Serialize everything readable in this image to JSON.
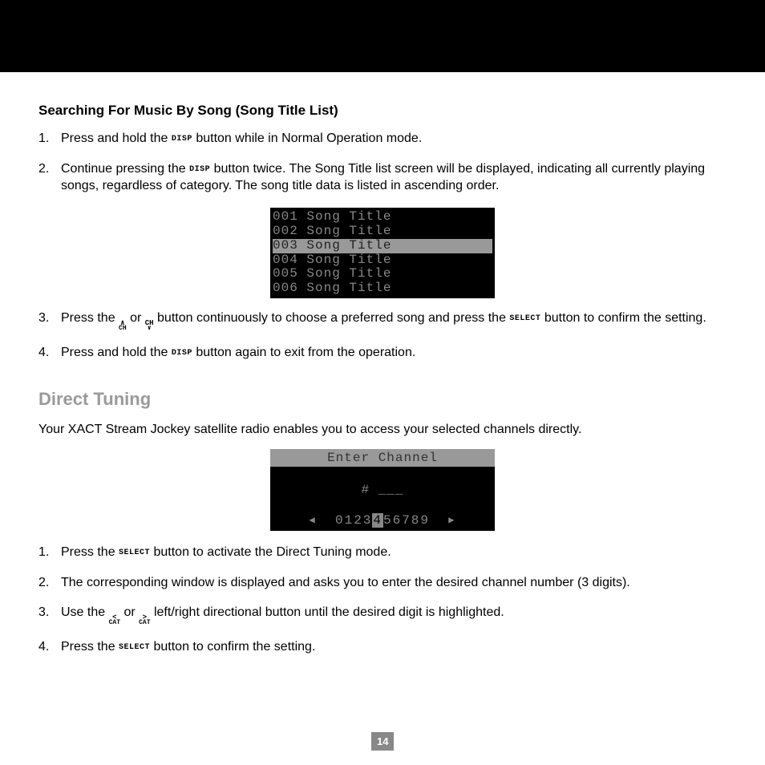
{
  "section1": {
    "title": "Searching For Music By Song (Song Title List)",
    "steps": [
      {
        "n": "1.",
        "pre": "Press and hold the ",
        "btn": "DISP",
        "post": " button while in Normal Operation mode."
      },
      {
        "n": "2.",
        "pre": "Continue pressing the ",
        "btn": "DISP",
        "post": " button twice. The Song Title list screen will be displayed, indicating all currently playing songs, regardless of category. The song title data is listed in ascending order."
      },
      {
        "n": "3.",
        "pre": "Press the ",
        "btn_stack1": {
          "top": "∧",
          "bot": "CH"
        },
        "mid1": " or ",
        "btn_stack2": {
          "top": "CH",
          "bot": "∨"
        },
        "mid2": " button continuously to choose a preferred song and press the ",
        "btn2": "SELECT",
        "post": " button to confirm the setting."
      },
      {
        "n": "4.",
        "pre": "Press and hold the ",
        "btn": "DISP",
        "post": " button again to exit from the operation."
      }
    ],
    "lcd_rows": [
      {
        "text": "001 Song Title",
        "hl": false
      },
      {
        "text": "002 Song Title",
        "hl": false
      },
      {
        "text": "003 Song Title",
        "hl": true
      },
      {
        "text": "004 Song Title",
        "hl": false
      },
      {
        "text": "005 Song Title",
        "hl": false
      },
      {
        "text": "006 Song Title",
        "hl": false
      }
    ]
  },
  "section2": {
    "heading": "Direct Tuning",
    "intro": "Your XACT Stream Jockey satellite radio enables you to access your selected channels directly.",
    "lcd": {
      "header": "Enter Channel",
      "mid": "# ___",
      "digits_left": "0123",
      "digits_hl": "4",
      "digits_right": "56789"
    },
    "steps": [
      {
        "n": "1.",
        "pre": "Press the ",
        "btn": "SELECT",
        "post": " button to activate the Direct Tuning mode."
      },
      {
        "n": "2.",
        "pre": "The corresponding window is displayed and asks you to enter the desired channel number (3 digits).",
        "btn": "",
        "post": ""
      },
      {
        "n": "3.",
        "pre": "Use the ",
        "btn_stack1": {
          "top": "<",
          "bot": "CAT"
        },
        "mid1": " or ",
        "btn_stack2": {
          "top": ">",
          "bot": "CAT"
        },
        "post": " left/right directional button until the desired digit is highlighted."
      },
      {
        "n": "4.",
        "pre": "Press the ",
        "btn": "SELECT",
        "post": " button to confirm the setting."
      }
    ]
  },
  "page_number": "14",
  "icons": {
    "tri_left": "◀",
    "tri_right": "▶"
  }
}
